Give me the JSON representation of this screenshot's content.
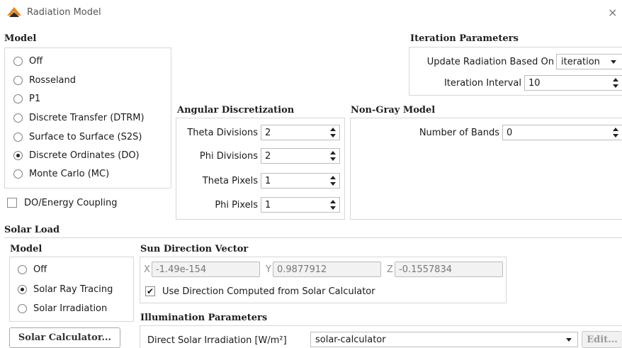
{
  "window": {
    "title": "Radiation Model",
    "close": "×"
  },
  "model": {
    "heading": "Model",
    "options": [
      {
        "label": "Off",
        "checked": false
      },
      {
        "label": "Rosseland",
        "checked": false
      },
      {
        "label": "P1",
        "checked": false
      },
      {
        "label": "Discrete Transfer (DTRM)",
        "checked": false
      },
      {
        "label": "Surface to Surface (S2S)",
        "checked": false
      },
      {
        "label": "Discrete Ordinates (DO)",
        "checked": true
      },
      {
        "label": "Monte Carlo (MC)",
        "checked": false
      }
    ],
    "energy_coupling": {
      "label": "DO/Energy Coupling",
      "checked": false
    }
  },
  "angular": {
    "heading": "Angular Discretization",
    "theta_divisions": {
      "label": "Theta Divisions",
      "value": "2"
    },
    "phi_divisions": {
      "label": "Phi Divisions",
      "value": "2"
    },
    "theta_pixels": {
      "label": "Theta Pixels",
      "value": "1"
    },
    "phi_pixels": {
      "label": "Phi Pixels",
      "value": "1"
    }
  },
  "iteration": {
    "heading": "Iteration Parameters",
    "update_label": "Update Radiation Based On",
    "update_value": "iteration",
    "interval_label": "Iteration Interval",
    "interval_value": "10"
  },
  "nongray": {
    "heading": "Non-Gray Model",
    "bands_label": "Number of Bands",
    "bands_value": "0"
  },
  "solar": {
    "heading": "Solar Load",
    "model_heading": "Model",
    "options": [
      {
        "label": "Off",
        "checked": false
      },
      {
        "label": "Solar Ray Tracing",
        "checked": true
      },
      {
        "label": "Solar Irradiation",
        "checked": false
      }
    ],
    "sun_heading": "Sun Direction Vector",
    "x_label": "X",
    "x_value": "-1.49e-154",
    "y_label": "Y",
    "y_value": "0.9877912",
    "z_label": "Z",
    "z_value": "-0.1557834",
    "use_calculator": {
      "label": "Use Direction Computed from Solar Calculator",
      "checked": true,
      "mark": "✔"
    },
    "illum_heading": "Illumination Parameters",
    "direct_label": "Direct Solar Irradiation [W/m²]",
    "direct_value": "solar-calculator",
    "edit_label": "Edit...",
    "calculator_button": "Solar Calculator..."
  },
  "colors": {
    "logo_orange": "#e8891a",
    "logo_dark": "#2b2b2b"
  }
}
